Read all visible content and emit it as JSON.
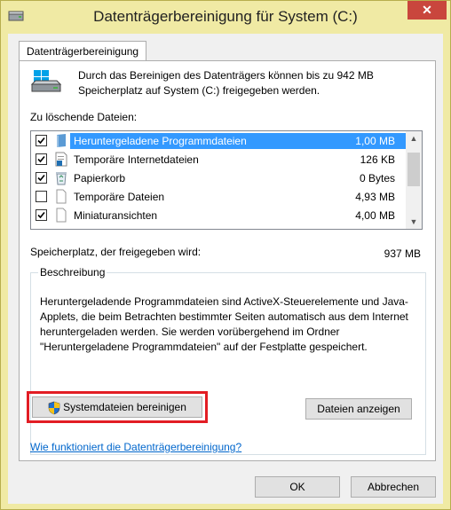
{
  "window": {
    "title": "Datenträgerbereinigung für System (C:)",
    "close_glyph": "✕"
  },
  "tab": {
    "label": "Datenträgerbereinigung"
  },
  "intro": "Durch das Bereinigen des Datenträgers können bis zu 942 MB Speicherplatz auf System (C:) freigegeben werden.",
  "files_label": "Zu löschende Dateien:",
  "files": [
    {
      "name": "Heruntergeladene Programmdateien",
      "size": "1,00 MB",
      "checked": true,
      "selected": true,
      "icon": "folder-icon"
    },
    {
      "name": "Temporäre Internetdateien",
      "size": "126 KB",
      "checked": true,
      "selected": false,
      "icon": "document-lock-icon"
    },
    {
      "name": "Papierkorb",
      "size": "0 Bytes",
      "checked": true,
      "selected": false,
      "icon": "recycle-bin-icon"
    },
    {
      "name": "Temporäre Dateien",
      "size": "4,93 MB",
      "checked": false,
      "selected": false,
      "icon": "blank-file-icon"
    },
    {
      "name": "Miniaturansichten",
      "size": "4,00 MB",
      "checked": true,
      "selected": false,
      "icon": "blank-file-icon"
    }
  ],
  "space_label": "Speicherplatz, der freigegeben wird:",
  "space_value": "937 MB",
  "description": {
    "title": "Beschreibung",
    "text": "Heruntergeladende Programmdateien sind ActiveX-Steuerelemente und Java-Applets, die beim Betrachten bestimmter Seiten automatisch aus dem Internet heruntergeladen werden. Sie werden vorübergehend im Ordner \"Heruntergeladene Programmdateien\" auf der Festplatte gespeichert."
  },
  "buttons": {
    "cleanup_system": "Systemdateien bereinigen",
    "view_files": "Dateien anzeigen",
    "ok": "OK",
    "cancel": "Abbrechen"
  },
  "link": "Wie funktioniert die Datenträgerbereinigung?",
  "colors": {
    "title_bar": "#f0eaa4",
    "selection": "#3399ff",
    "highlight_border": "#e21d24",
    "link": "#0066cc"
  }
}
